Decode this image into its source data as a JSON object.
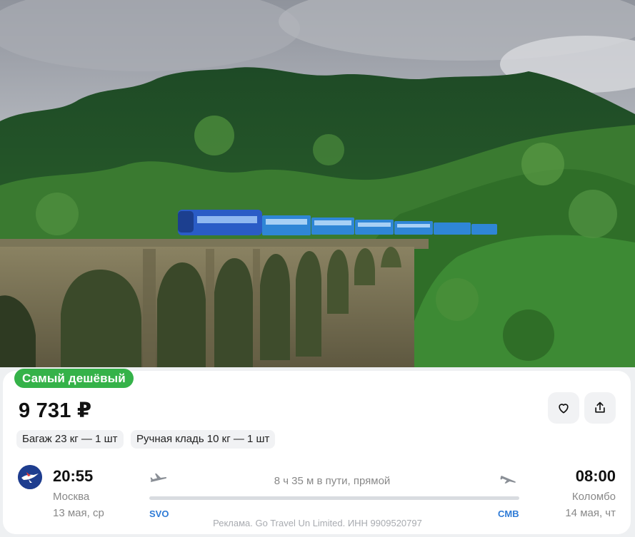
{
  "hero": {
    "icon": "train-bridge-photo"
  },
  "offer": {
    "badge": "Самый дешёвый",
    "price": "9 731 ₽",
    "favorite_icon": "heart-icon",
    "share_icon": "share-icon",
    "baggage": "Багаж 23 кг — 1 шт",
    "hand_luggage": "Ручная кладь 10 кг — 1 шт"
  },
  "flight": {
    "airline_icon": "aeroflot-logo",
    "departure": {
      "time": "20:55",
      "city": "Москва",
      "date": "13 мая, ср",
      "iata": "SVO"
    },
    "arrival": {
      "time": "08:00",
      "city": "Коломбо",
      "date": "14 мая, чт",
      "iata": "CMB"
    },
    "duration": "8 ч 35 м в пути, прямой"
  },
  "footer": {
    "ad_text": "Реклама. Go Travel Un Limited. ИНН 9909520797"
  },
  "colors": {
    "badge": "#35b249",
    "iata": "#2f7bd6",
    "muted_text": "#888888",
    "chip_bg": "#f1f2f4"
  }
}
